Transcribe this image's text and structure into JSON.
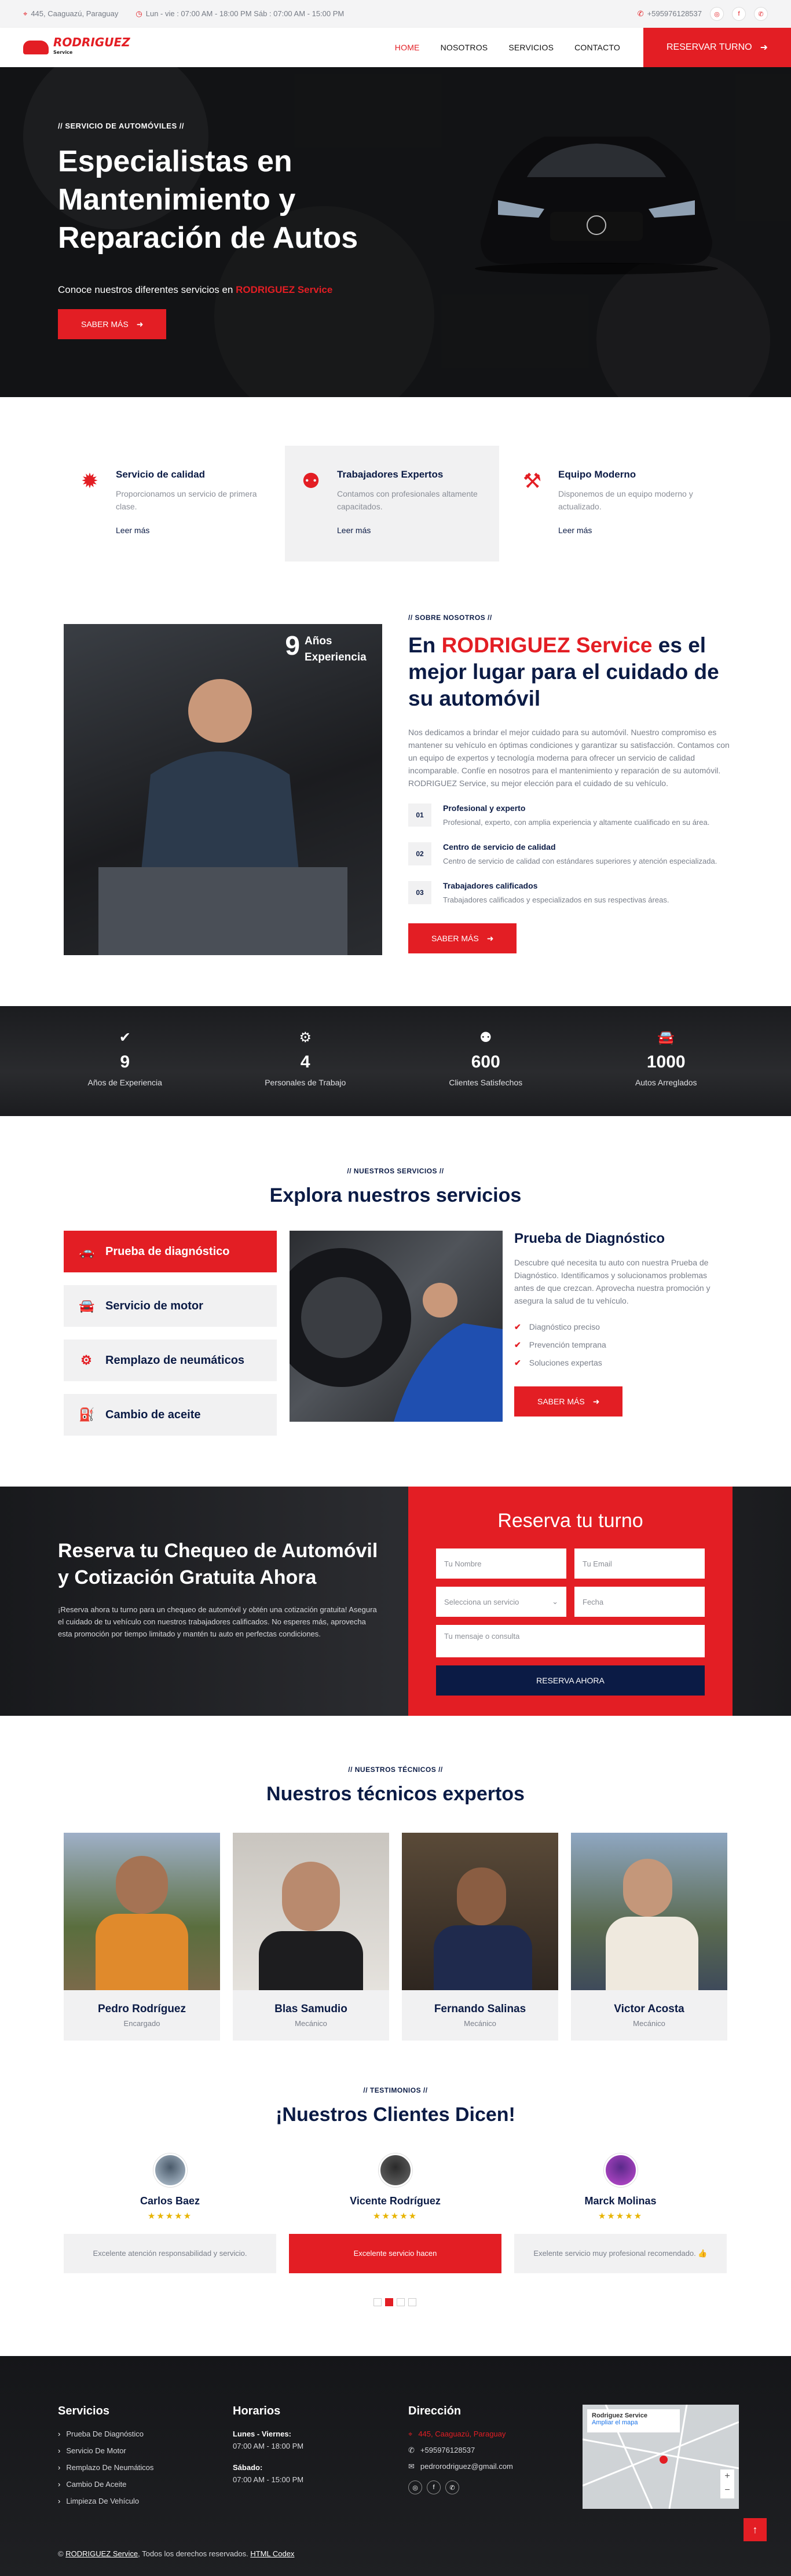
{
  "topbar": {
    "address": "445, Caaguazú, Paraguay",
    "hours": "Lun - vie : 07:00 AM - 18:00 PM Sáb : 07:00 AM - 15:00 PM",
    "phone": "+595976128537"
  },
  "nav": {
    "brand": "RODRIGUEZ",
    "brand_sub": "Service",
    "items": [
      "HOME",
      "NOSOTROS",
      "SERVICIOS",
      "CONTACTO"
    ],
    "cta": "RESERVAR TURNO"
  },
  "hero": {
    "tag": "// SERVICIO DE AUTOMÓVILES //",
    "title": "Especialistas en Mantenimiento y Reparación de Autos",
    "sub_prefix": "Conoce nuestros diferentes servicios en ",
    "sub_brand": "RODRIGUEZ Service",
    "button": "SABER MÁS"
  },
  "features": [
    {
      "icon": "gear-icon",
      "title": "Servicio de calidad",
      "text": "Proporcionamos un servicio de primera clase.",
      "link": "Leer más"
    },
    {
      "icon": "users-icon",
      "title": "Trabajadores Expertos",
      "text": "Contamos con profesionales altamente capacitados.",
      "link": "Leer más"
    },
    {
      "icon": "tools-icon",
      "title": "Equipo Moderno",
      "text": "Disponemos de un equipo moderno y actualizado.",
      "link": "Leer más"
    }
  ],
  "about": {
    "tag": "// SOBRE NOSOTROS //",
    "badge_num": "9",
    "badge_text": "Años Experiencia",
    "title_prefix": "En ",
    "title_brand": "RODRIGUEZ Service",
    "title_suffix": " es el mejor lugar para el cuidado de su automóvil",
    "text": "Nos dedicamos a brindar el mejor cuidado para su automóvil. Nuestro compromiso es mantener su vehículo en óptimas condiciones y garantizar su satisfacción. Contamos con un equipo de expertos y tecnología moderna para ofrecer un servicio de calidad incomparable. Confíe en nosotros para el mantenimiento y reparación de su automóvil. RODRIGUEZ Service, su mejor elección para el cuidado de su vehículo.",
    "points": [
      {
        "num": "01",
        "title": "Profesional y experto",
        "text": "Profesional, experto, con amplia experiencia y altamente cualificado en su área."
      },
      {
        "num": "02",
        "title": "Centro de servicio de calidad",
        "text": "Centro de servicio de calidad con estándares superiores y atención especializada."
      },
      {
        "num": "03",
        "title": "Trabajadores calificados",
        "text": "Trabajadores calificados y especializados en sus respectivas áreas."
      }
    ],
    "button": "SABER MÁS"
  },
  "stats": [
    {
      "icon": "check-icon",
      "value": "9",
      "label": "Años de Experiencia"
    },
    {
      "icon": "users-gear-icon",
      "value": "4",
      "label": "Personales de Trabajo"
    },
    {
      "icon": "users-icon",
      "value": "600",
      "label": "Clientes Satisfechos"
    },
    {
      "icon": "car-icon",
      "value": "1000",
      "label": "Autos Arreglados"
    }
  ],
  "services": {
    "tag": "// NUESTROS SERVICIOS //",
    "title": "Explora nuestros servicios",
    "items": [
      {
        "icon": "car-front-icon",
        "label": "Prueba de diagnóstico"
      },
      {
        "icon": "car-icon",
        "label": "Servicio de motor"
      },
      {
        "icon": "cog-icon",
        "label": "Remplazo de neumáticos"
      },
      {
        "icon": "oil-can-icon",
        "label": "Cambio de aceite"
      }
    ],
    "detail_title": "Prueba de Diagnóstico",
    "detail_text": "Descubre qué necesita tu auto con nuestra Prueba de Diagnóstico. Identificamos y solucionamos problemas antes de que crezcan. Aprovecha nuestra promoción y asegura la salud de tu vehículo.",
    "checks": [
      "Diagnóstico preciso",
      "Prevención temprana",
      "Soluciones expertas"
    ],
    "button": "SABER MÁS"
  },
  "booking": {
    "title": "Reserva tu Chequeo de Automóvil y Cotización Gratuita Ahora",
    "text": "¡Reserva ahora tu turno para un chequeo de automóvil y obtén una cotización gratuita! Asegura el cuidado de tu vehículo con nuestros trabajadores calificados. No esperes más, aprovecha esta promoción por tiempo limitado y mantén tu auto en perfectas condiciones.",
    "form_title": "Reserva tu turno",
    "name_ph": "Tu Nombre",
    "email_ph": "Tu Email",
    "service_ph": "Selecciona un servicio",
    "date_ph": "Fecha",
    "msg_ph": "Tu mensaje o consulta",
    "submit": "RESERVA AHORA"
  },
  "team": {
    "tag": "// NUESTROS TÉCNICOS //",
    "title": "Nuestros técnicos expertos",
    "members": [
      {
        "name": "Pedro Rodríguez",
        "role": "Encargado"
      },
      {
        "name": "Blas Samudio",
        "role": "Mecánico"
      },
      {
        "name": "Fernando Salinas",
        "role": "Mecánico"
      },
      {
        "name": "Victor Acosta",
        "role": "Mecánico"
      }
    ]
  },
  "testimonials": {
    "tag": "// TESTIMONIOS //",
    "title": "¡Nuestros Clientes Dicen!",
    "items": [
      {
        "name": "Carlos Baez",
        "stars": "★★★★★",
        "quote": "Excelente atención responsabilidad y servicio."
      },
      {
        "name": "Vicente Rodríguez",
        "stars": "★★★★★",
        "quote": "Excelente servicio hacen"
      },
      {
        "name": "Marck Molinas",
        "stars": "★★★★★",
        "quote": "Exelente servicio muy profesional recomendado. 👍"
      }
    ]
  },
  "footer": {
    "services_title": "Servicios",
    "services": [
      "Prueba De Diagnóstico",
      "Servicio De Motor",
      "Remplazo De Neumáticos",
      "Cambio De Aceite",
      "Limpieza De Vehículo"
    ],
    "hours_title": "Horarios",
    "weekday_label": "Lunes - Viernes:",
    "weekday_hours": "07:00 AM - 18:00 PM",
    "sat_label": "Sábado:",
    "sat_hours": "07:00 AM - 15:00 PM",
    "address_title": "Dirección",
    "address": "445, Caaguazú, Paraguay",
    "phone": "+595976128537",
    "email": "pedrorodriguez@gmail.com",
    "map_title": "Rodriguez Service",
    "map_link": "Ampliar el mapa",
    "copyright_prefix": "© ",
    "copyright_brand": "RODRIGUEZ Service",
    "copyright_mid": ", Todos los derechos reservados. ",
    "copyright_tail": "HTML Codex"
  },
  "colors": {
    "accent": "#e31e24",
    "navy": "#0b1b45",
    "light": "#f1f1f2"
  }
}
